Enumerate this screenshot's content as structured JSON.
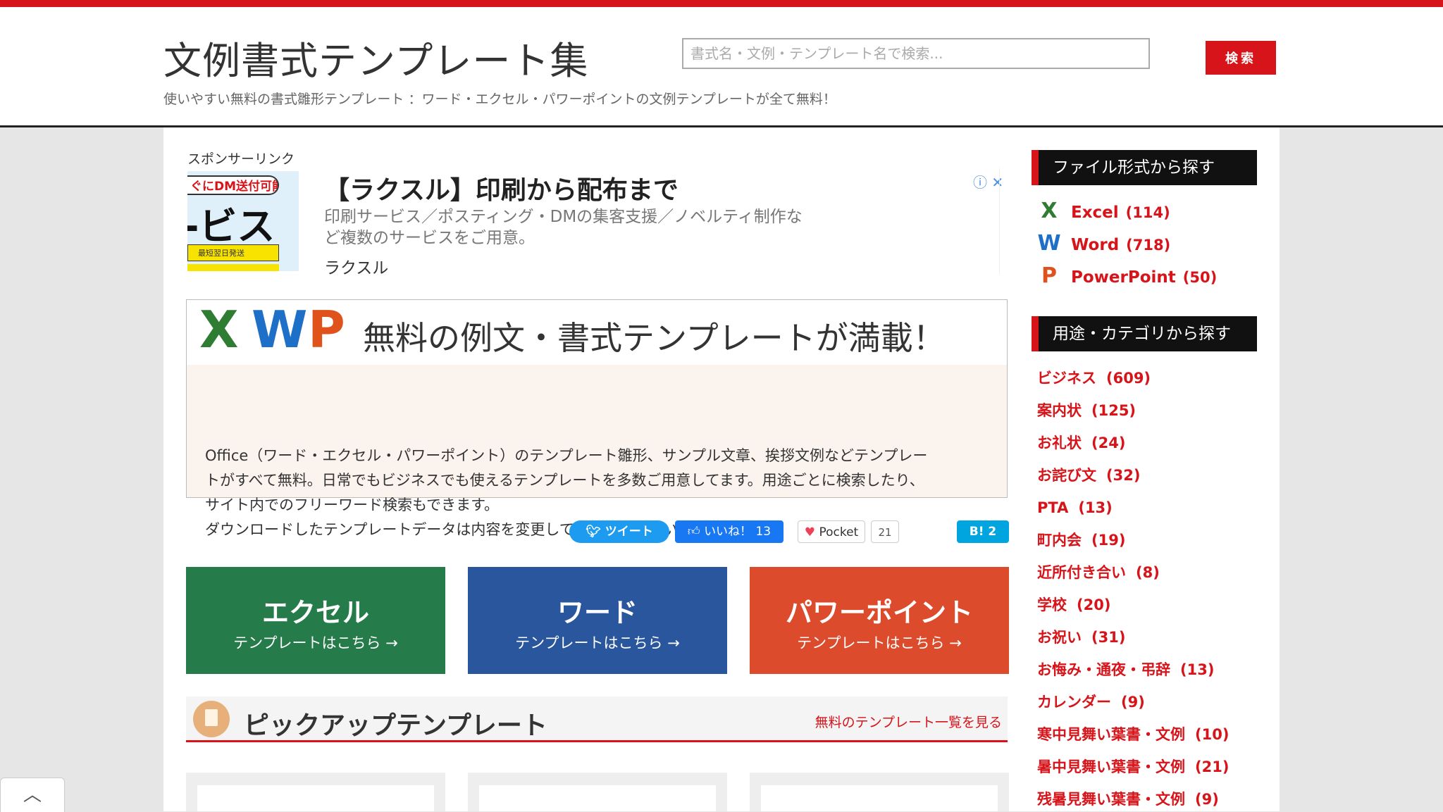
{
  "header": {
    "site_title": "文例書式テンプレート集",
    "subtitle": "使いやすい無料の書式雛形テンプレート ：ワード・エクセル・パワーポイントの文例テンプレートが全て無料！",
    "search_placeholder": "書式名・文例・テンプレート名で検索...",
    "search_button": "検索"
  },
  "ad": {
    "sponsor_label": "スポンサーリンク",
    "image_band": "ぐにDM送付可能",
    "image_big": "-ビス",
    "image_small": "最短翌日発送",
    "title": "【ラクスル】印刷から配布まで",
    "description": "印刷サービス／ポスティング・DMの集客支援／ノベルティ制作など複数のサービスをご用意。",
    "brand": "ラクスル",
    "info_icon": "ⓘ ✕"
  },
  "hero": {
    "logo_x": "X",
    "logo_w": "W",
    "logo_p": "P",
    "title": "無料の例文・書式テンプレートが満載！",
    "text_lines": [
      "Office（ワード・エクセル・パワーポイント）のテンプレート雛形、サンプル文章、挨拶文例などテンプレー",
      "トがすべて無料。日常でもビジネスでも使えるテンプレートを多数ご用意してます。用途ごとに検索したり、",
      "サイト内でのフリーワード検索もできます。",
      "ダウンロードしたテンプレートデータは内容を変更してご利用くださいませ。"
    ]
  },
  "share": {
    "tweet": "ツイート",
    "like": "いいね！ 13",
    "pocket": "Pocket",
    "pocket_count": "21",
    "hatena": "B! 2"
  },
  "tiles": [
    {
      "title": "エクセル",
      "sub": "テンプレートはこちら →",
      "color": "#257b4a"
    },
    {
      "title": "ワード",
      "sub": "テンプレートはこちら →",
      "color": "#29569c"
    },
    {
      "title": "パワーポイント",
      "sub": "テンプレートはこちら →",
      "color": "#dc4b2c"
    }
  ],
  "pickup": {
    "title": "ピックアップテンプレート",
    "link": "無料のテンプレート一覧を見る"
  },
  "sidebar": {
    "formats_heading": "ファイル形式から探す",
    "formats": [
      {
        "icon": "X",
        "name": "Excel",
        "count": "(114)",
        "icon_color": "#2e7d32"
      },
      {
        "icon": "W",
        "name": "Word",
        "count": "(718)",
        "icon_color": "#1e6fc8"
      },
      {
        "icon": "P",
        "name": "PowerPoint",
        "count": "(50)",
        "icon_color": "#e0521c"
      }
    ],
    "categories_heading": "用途・カテゴリから探す",
    "categories": [
      {
        "name": "ビジネス",
        "count": "(609)"
      },
      {
        "name": "案内状",
        "count": "(125)"
      },
      {
        "name": "お礼状",
        "count": "(24)"
      },
      {
        "name": "お詫び文",
        "count": "(32)"
      },
      {
        "name": "PTA",
        "count": "(13)"
      },
      {
        "name": "町内会",
        "count": "(19)"
      },
      {
        "name": "近所付き合い",
        "count": "(8)"
      },
      {
        "name": "学校",
        "count": "(20)"
      },
      {
        "name": "お祝い",
        "count": "(31)"
      },
      {
        "name": "お悔み・通夜・弔辞",
        "count": "(13)"
      },
      {
        "name": "カレンダー",
        "count": "(9)"
      },
      {
        "name": "寒中見舞い葉書・文例",
        "count": "(10)"
      },
      {
        "name": "暑中見舞い葉書・文例",
        "count": "(21)"
      },
      {
        "name": "残暑見舞い葉書・文例",
        "count": "(9)"
      }
    ]
  },
  "back_to_top": "︿",
  "colors": {
    "brand_red": "#d7141a"
  }
}
